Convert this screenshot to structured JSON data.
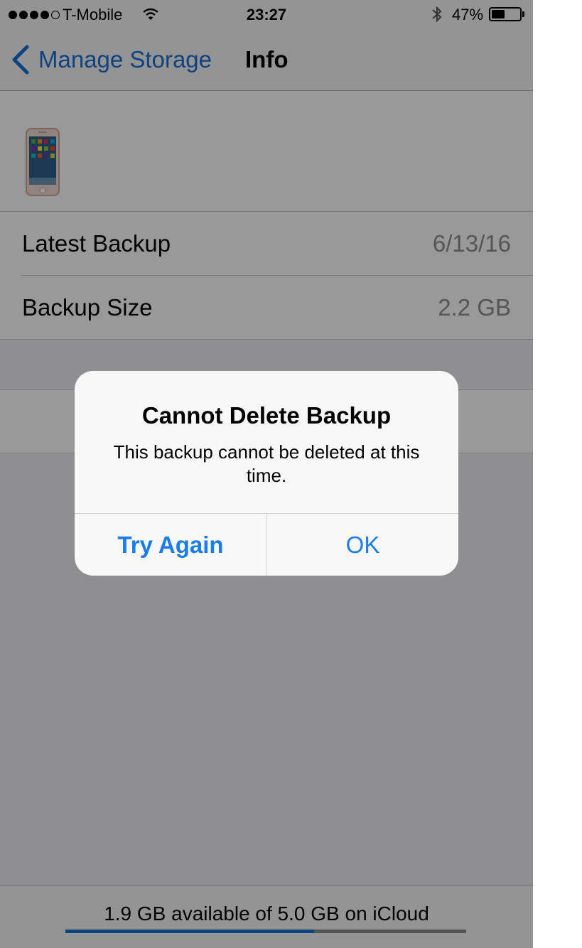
{
  "status_bar": {
    "carrier": "T-Mobile",
    "time": "23:27",
    "battery_percent": "47%",
    "battery_level": 0.47,
    "signal_bars_filled": 4,
    "signal_bars_total": 5
  },
  "nav": {
    "back_label": "Manage Storage",
    "title": "Info"
  },
  "device": {
    "icon": "iphone-device-icon"
  },
  "info_rows": [
    {
      "label": "Latest Backup",
      "value": "6/13/16"
    },
    {
      "label": "Backup Size",
      "value": "2.2 GB"
    }
  ],
  "footer": {
    "storage_text": "1.9 GB available of 5.0 GB on iCloud",
    "storage_used_fraction": 0.62
  },
  "alert": {
    "title": "Cannot Delete Backup",
    "message": "This backup cannot be deleted at this time.",
    "buttons": [
      {
        "label": "Try Again"
      },
      {
        "label": "OK"
      }
    ]
  },
  "colors": {
    "accent": "#1a6fd6",
    "alert_button": "#1a7cf0",
    "background": "#efeff4",
    "secondary_text": "#8e8e93"
  }
}
